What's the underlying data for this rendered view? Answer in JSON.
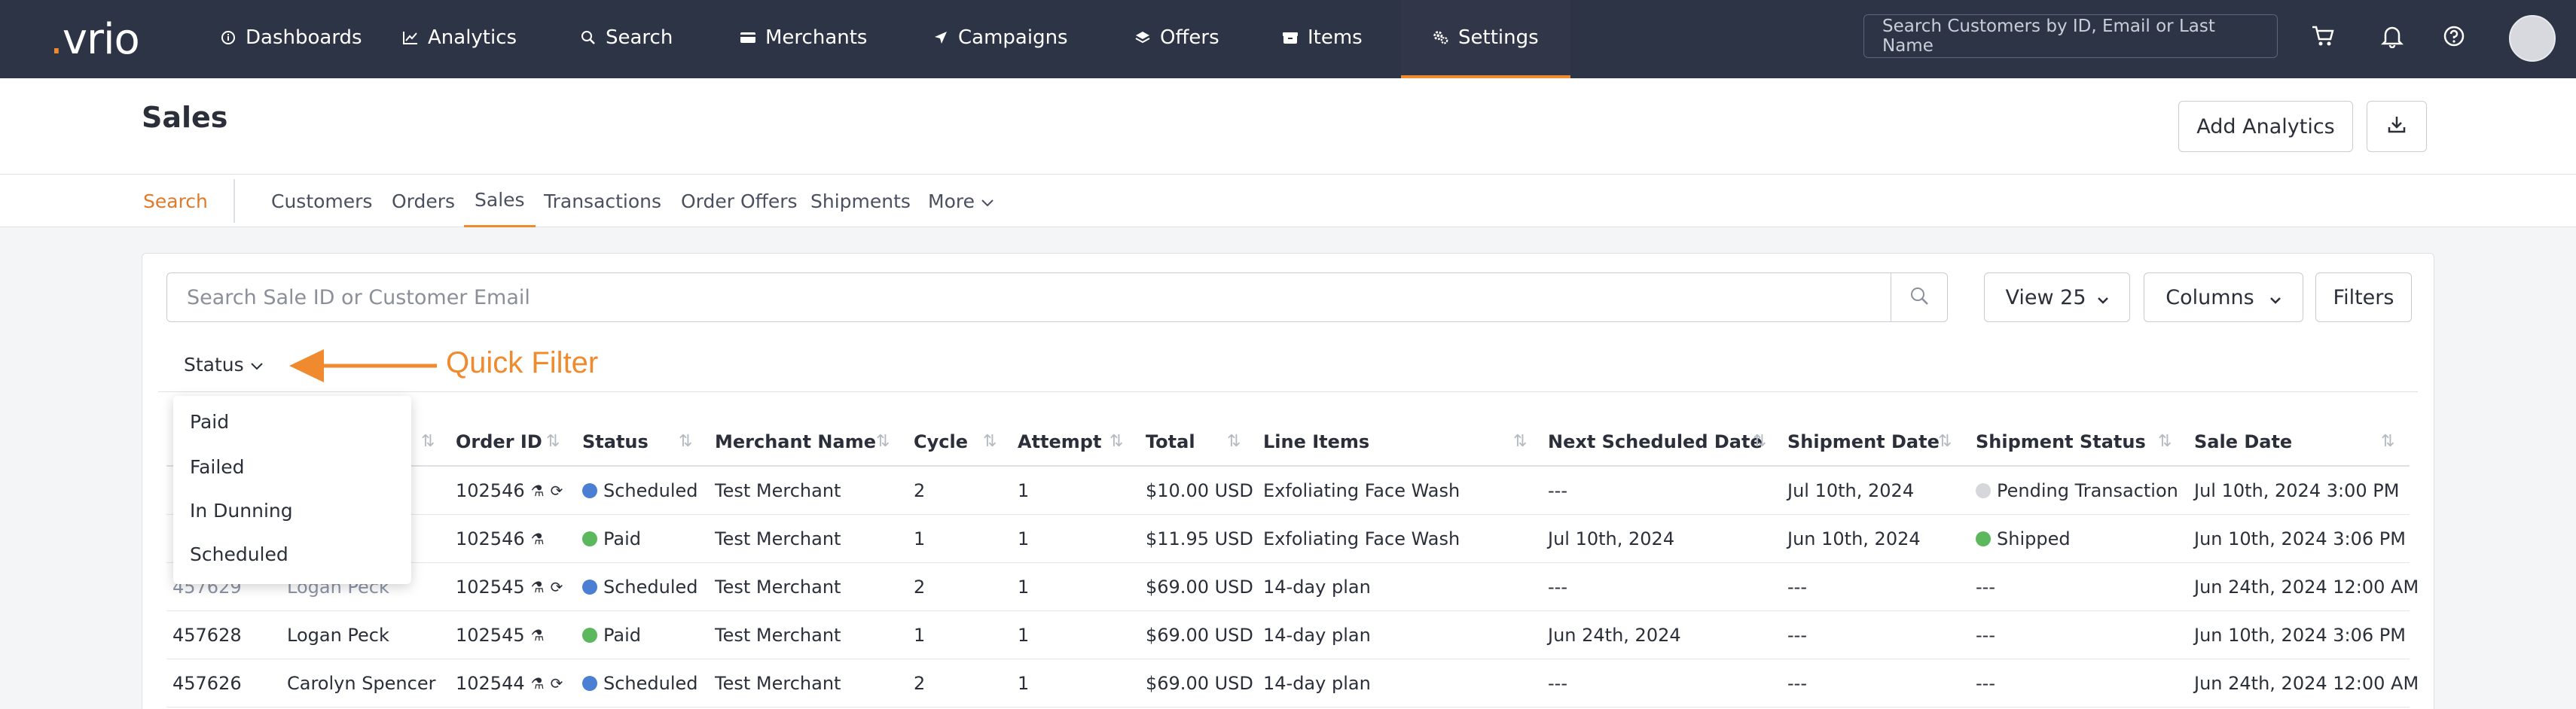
{
  "nav": {
    "logo_main": "vrio",
    "items": [
      {
        "label": "Dashboards",
        "icon": "info-icon"
      },
      {
        "label": "Analytics",
        "icon": "chart-line-icon"
      },
      {
        "label": "Search",
        "icon": "search-icon"
      },
      {
        "label": "Merchants",
        "icon": "credit-card-icon"
      },
      {
        "label": "Campaigns",
        "icon": "paper-plane-icon"
      },
      {
        "label": "Offers",
        "icon": "layers-icon"
      },
      {
        "label": "Items",
        "icon": "box-icon"
      },
      {
        "label": "Settings",
        "icon": "gears-icon"
      }
    ],
    "active": "Settings",
    "search_placeholder": "Search Customers by ID, Email or Last Name"
  },
  "header": {
    "title": "Sales",
    "add_analytics_label": "Add Analytics"
  },
  "subnav": {
    "items": [
      "Search",
      "Customers",
      "Orders",
      "Sales",
      "Transactions",
      "Order Offers",
      "Shipments",
      "More"
    ],
    "active": "Sales"
  },
  "toolbar": {
    "search_placeholder": "Search Sale ID or Customer Email",
    "view_label": "View 25",
    "columns_label": "Columns",
    "filters_label": "Filters"
  },
  "quick_filter": {
    "status_label": "Status",
    "annotation": "Quick Filter",
    "options": [
      "Paid",
      "Failed",
      "In Dunning",
      "Scheduled"
    ]
  },
  "table": {
    "columns": [
      "Order ID",
      "Status",
      "Merchant Name",
      "Cycle",
      "Attempt",
      "Total",
      "Line Items",
      "Next Scheduled Date",
      "Shipment Date",
      "Shipment Status",
      "Sale Date"
    ],
    "rows": [
      {
        "sale_id": "",
        "customer": "",
        "order_id": "102546",
        "status": "Scheduled",
        "merchant": "Test Merchant",
        "cycle": "2",
        "attempt": "1",
        "total": "$10.00 USD",
        "line_items": "Exfoliating Face Wash",
        "next_date": "---",
        "ship_date": "Jul 10th, 2024",
        "ship_status": "Pending Transaction",
        "sale_date": "Jul 10th, 2024 3:00 PM"
      },
      {
        "sale_id": "",
        "customer": "",
        "order_id": "102546",
        "status": "Paid",
        "merchant": "Test Merchant",
        "cycle": "1",
        "attempt": "1",
        "total": "$11.95 USD",
        "line_items": "Exfoliating Face Wash",
        "next_date": "Jul 10th, 2024",
        "ship_date": "Jun 10th, 2024",
        "ship_status": "Shipped",
        "sale_date": "Jun 10th, 2024 3:06 PM"
      },
      {
        "sale_id": "457629",
        "customer": "Logan Peck",
        "order_id": "102545",
        "status": "Scheduled",
        "merchant": "Test Merchant",
        "cycle": "2",
        "attempt": "1",
        "total": "$69.00 USD",
        "line_items": "14-day plan",
        "next_date": "---",
        "ship_date": "---",
        "ship_status": "---",
        "sale_date": "Jun 24th, 2024 12:00 AM"
      },
      {
        "sale_id": "457628",
        "customer": "Logan Peck",
        "order_id": "102545",
        "status": "Paid",
        "merchant": "Test Merchant",
        "cycle": "1",
        "attempt": "1",
        "total": "$69.00 USD",
        "line_items": "14-day plan",
        "next_date": "Jun 24th, 2024",
        "ship_date": "---",
        "ship_status": "---",
        "sale_date": "Jun 10th, 2024 3:06 PM"
      },
      {
        "sale_id": "457626",
        "customer": "Carolyn Spencer",
        "order_id": "102544",
        "status": "Scheduled",
        "merchant": "Test Merchant",
        "cycle": "2",
        "attempt": "1",
        "total": "$69.00 USD",
        "line_items": "14-day plan",
        "next_date": "---",
        "ship_date": "---",
        "ship_status": "---",
        "sale_date": "Jun 24th, 2024 12:00 AM"
      }
    ]
  },
  "colors": {
    "nav_bg": "#2d3446",
    "accent": "#ef8a2f",
    "scheduled": "#4a7fd4",
    "paid": "#5cb85c",
    "pending": "#d5d7db"
  }
}
